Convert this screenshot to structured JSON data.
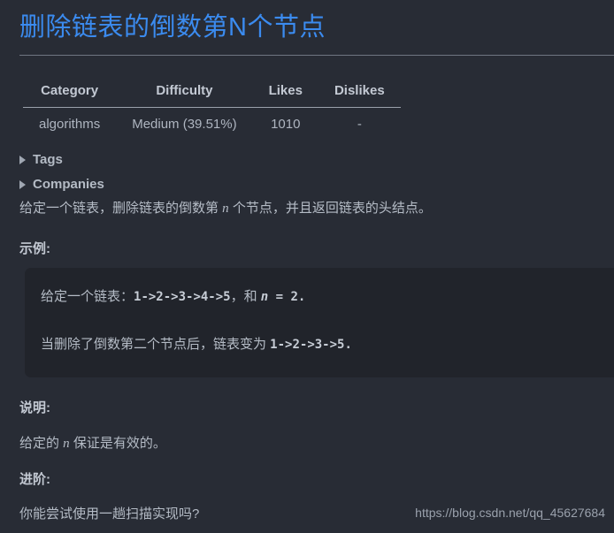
{
  "title": "删除链表的倒数第N个节点",
  "title_color": "#3b8bef",
  "background_color": "#282c35",
  "code_background_color": "#21242b",
  "meta_table": {
    "headers": [
      "Category",
      "Difficulty",
      "Likes",
      "Dislikes"
    ],
    "rows": [
      [
        "algorithms",
        "Medium (39.51%)",
        "1010",
        "-"
      ]
    ]
  },
  "collapsibles": [
    {
      "label": "Tags",
      "marker": "triangle-right-icon",
      "expanded": false
    },
    {
      "label": "Companies",
      "marker": "triangle-right-icon",
      "expanded": false
    }
  ],
  "description": {
    "part1": "给定一个链表，删除链表的倒数第 ",
    "var": "n",
    "part2": " 个节点，并且返回链表的头结点。"
  },
  "example": {
    "label": "示例:",
    "line1": {
      "text_before": "给定一个链表：",
      "code1": "1->2->3->4->5",
      "text_middle": "，和 ",
      "var": "n",
      "code2": " = 2."
    },
    "line2": {
      "text_before": "当删除了倒数第二个节点后，链表变为 ",
      "code1": "1->2->3->5."
    }
  },
  "note": {
    "label": "说明:",
    "part1": "给定的 ",
    "var": "n",
    "part2": " 保证是有效的。"
  },
  "advanced": {
    "label": "进阶:",
    "text": "你能尝试使用一趟扫描实现吗?"
  },
  "watermark": "https://blog.csdn.net/qq_45627684"
}
